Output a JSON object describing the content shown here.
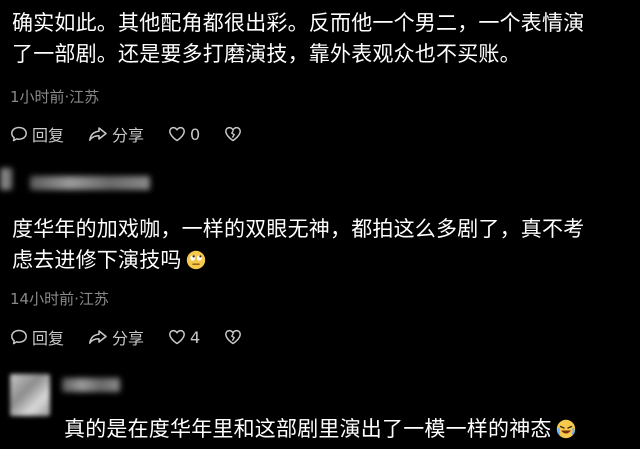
{
  "comments": [
    {
      "text_line1": "确实如此。其他配角都很出彩。反而他一个男二，一个表情演",
      "text_line2": "了一部剧。还是要多打磨演技，靠外表观众也不买账。",
      "meta": "1小时前·江苏",
      "reply_label": "回复",
      "share_label": "分享",
      "like_count": "0"
    },
    {
      "text_line1": "度华年的加戏咖，一样的双眼无神，都拍这么多剧了，真不考",
      "text_line2": "虑去进修下演技吗",
      "emoji": "eye-roll-emoji",
      "meta": "14小时前·江苏",
      "reply_label": "回复",
      "share_label": "分享",
      "like_count": "4"
    },
    {
      "text_line1": "真的是在度华年里和这部剧里演出了一模一样的神态",
      "emoji": "rolling-laughing-emoji"
    }
  ],
  "colors": {
    "background": "#000000",
    "text": "#ffffff",
    "meta": "#8a8a8a",
    "action": "#c8c8c8"
  }
}
